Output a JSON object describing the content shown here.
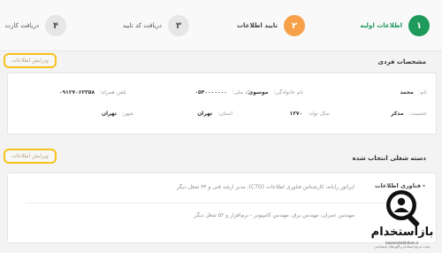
{
  "stepper": {
    "steps": [
      {
        "number": "۱",
        "label": "اطلاعات اولیه"
      },
      {
        "number": "۲",
        "label": "تایید اطلاعات"
      },
      {
        "number": "۳",
        "label": "دریافت کد تایید"
      },
      {
        "number": "۴",
        "label": "دریافت کارت"
      }
    ]
  },
  "personal": {
    "title": "مشخصات فردی",
    "edit_label": "ویرایش اطلاعات",
    "fields": {
      "first_name_key": "نام:",
      "first_name": "محمد",
      "last_name_key": "نام خانوادگی:",
      "last_name": "موسوی",
      "national_code_key": "کد ملی:",
      "national_code": "۰۵۴۰۰۰۰۰۰۰",
      "mobile_key": "تلفن همراه:",
      "mobile": "۰۹۱۲۷۰۶۲۳۵۸",
      "gender_key": "جنسیت:",
      "gender": "مذکر",
      "birth_year_key": "سال تولد:",
      "birth_year": "۱۳۷۰",
      "province_key": "استان:",
      "province": "تهران",
      "city_key": "شهر:",
      "city": "تهران"
    }
  },
  "job": {
    "title": "دسته شغلی انتخاب شده",
    "edit_label": "ویرایش اطلاعات",
    "category": "فناوری اطلاعات",
    "desc1": "اپراتور رایانه، کارشناس فناوری اطلاعات (CTO)، مدیر ارشد فنی و ۳۴ شغل دیگر",
    "desc2": "مهندس عمران، مهندس برق، مهندس کامپیوتر - نرم‌افزار و ۵۲ شغل دیگر"
  },
  "logo": {
    "brand": "بازاستخدام",
    "url": "bazarestekhdam.ir",
    "tagline": "سایت مرجع استخدام و آگهی‌های استخدامی"
  }
}
